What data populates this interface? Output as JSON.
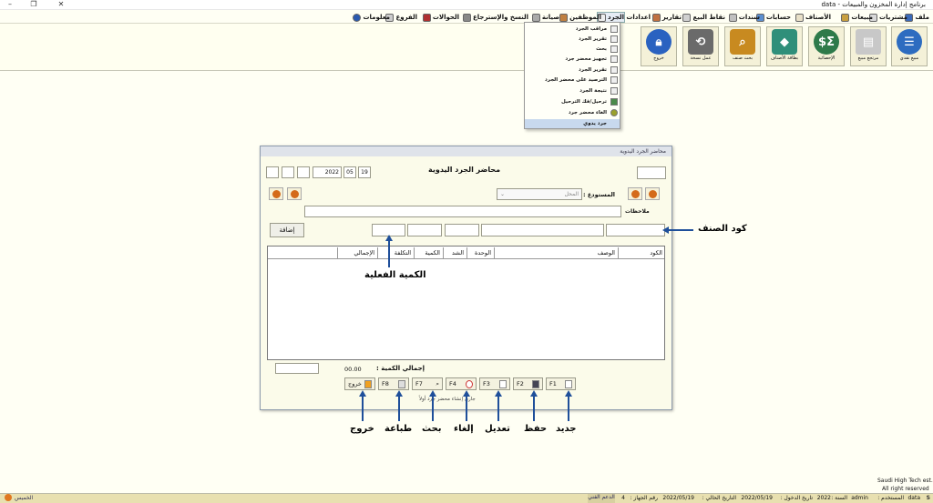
{
  "window": {
    "title": "برنامج إدارة المخزون والمبيعات - data"
  },
  "menu": [
    "ملف",
    "مشتريات",
    "مبيعات",
    "الأصناف",
    "حسابات",
    "سندات",
    "نقاط البيع",
    "تقارير",
    "اعدادات",
    "الجرد",
    "الموظفين",
    "صيانة",
    "النسخ والإسترجاع",
    "الحوالات",
    "الفروع",
    "معلومات"
  ],
  "toolbar": [
    "مبيع نقدي",
    "مرتجع مبيع",
    "الإحصائية",
    "بطاقة الأصناف",
    "بحث صنف",
    "عمل نسخة",
    "خروج"
  ],
  "dropdown": [
    "مراقب الجرد",
    "تقرير الجرد",
    "بحث",
    "تجهيز محضر جرد",
    "تقرير الجرد",
    "الترصيد على محضر الجرد",
    "نتيجة الجرد",
    "ترحيل/فك الترحيل",
    "الغاء محضر جرد",
    "جرد يدوي"
  ],
  "dialog": {
    "caption": "محاضر الجرد اليدوية",
    "heading": "محاضر الجرد اليدوية",
    "date": {
      "day": "19",
      "month": "05",
      "year": "2022"
    },
    "warehouse_label": "المستودع :",
    "warehouse_value": "المحل",
    "notes_label": "ملاحظات",
    "add_button": "إضافة",
    "columns": [
      "الكود",
      "الوصف",
      "الوحدة",
      "الشد",
      "الكمية",
      "التكلفة",
      "الإجمالي"
    ],
    "total_label": "إجمالي الكمية :",
    "total_value": "00.00",
    "status_text": "جاري إنشاء محضر جرد أولاً"
  },
  "fkeys": [
    "F1",
    "F2",
    "F3",
    "F4",
    "F7",
    "F8",
    "خروج"
  ],
  "annotations": {
    "code": "كود الصنف",
    "actual_qty": "الكمية الفعلية",
    "new": "جديد",
    "save": "حفظ",
    "edit": "تعديل",
    "cancel": "إلغاء",
    "search": "بحث",
    "print": "طباعة",
    "exit": "خروج"
  },
  "footer": {
    "company": "Saudi High Tech est.",
    "rights": "All right reserved"
  },
  "status": {
    "db": "data",
    "user_label": "المستخدم :",
    "user": "admin",
    "year_label": "السنة :",
    "year": "2022",
    "login_label": "تاريخ الدخول :",
    "login_date": "2022/05/19",
    "current_label": "التاريخ الحالي :",
    "current_date": "2022/05/19",
    "device_label": "رقم الجهاز :",
    "device": "4",
    "support": "الدعم الفني",
    "day": "الخميس"
  },
  "colors": {
    "accent": "#1f4f9a",
    "background": "#fffff4"
  }
}
